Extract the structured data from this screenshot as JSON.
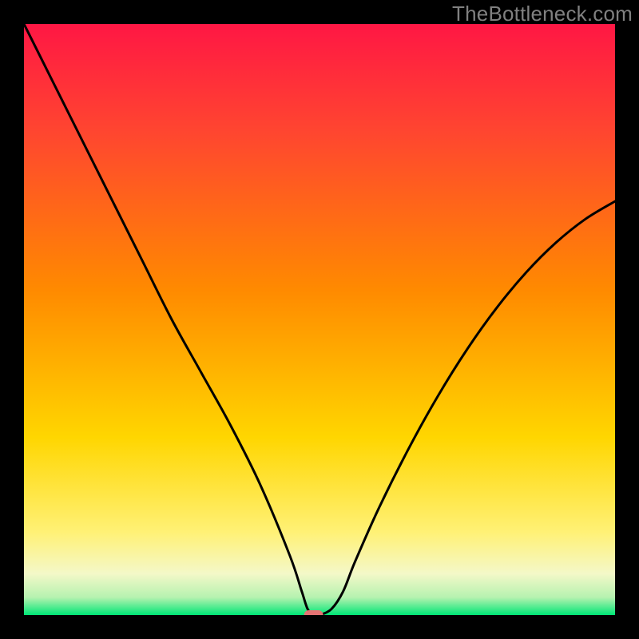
{
  "watermark": "TheBottleneck.com",
  "chart_data": {
    "type": "line",
    "title": "",
    "xlabel": "",
    "ylabel": "",
    "xlim": [
      0,
      100
    ],
    "ylim": [
      0,
      100
    ],
    "grid": false,
    "legend": false,
    "background_gradient": {
      "top": "#ff1744",
      "mid_upper": "#ff8a00",
      "mid": "#ffd600",
      "mid_lower": "#fff176",
      "bottom": "#00e676"
    },
    "series": [
      {
        "name": "bottleneck-curve",
        "color": "#000000",
        "x": [
          0,
          5,
          10,
          15,
          20,
          25,
          30,
          35,
          40,
          45,
          47,
          48,
          49,
          50,
          52,
          54,
          56,
          60,
          65,
          70,
          75,
          80,
          85,
          90,
          95,
          100
        ],
        "values": [
          100,
          90,
          80,
          70,
          60,
          50,
          41,
          32,
          22,
          10,
          4,
          1,
          0,
          0,
          1,
          4,
          9,
          18,
          28,
          37,
          45,
          52,
          58,
          63,
          67,
          70
        ]
      }
    ],
    "marker": {
      "name": "optimal-point",
      "x": 49,
      "y": 0,
      "color": "#e57373",
      "shape": "rounded-rect"
    }
  }
}
